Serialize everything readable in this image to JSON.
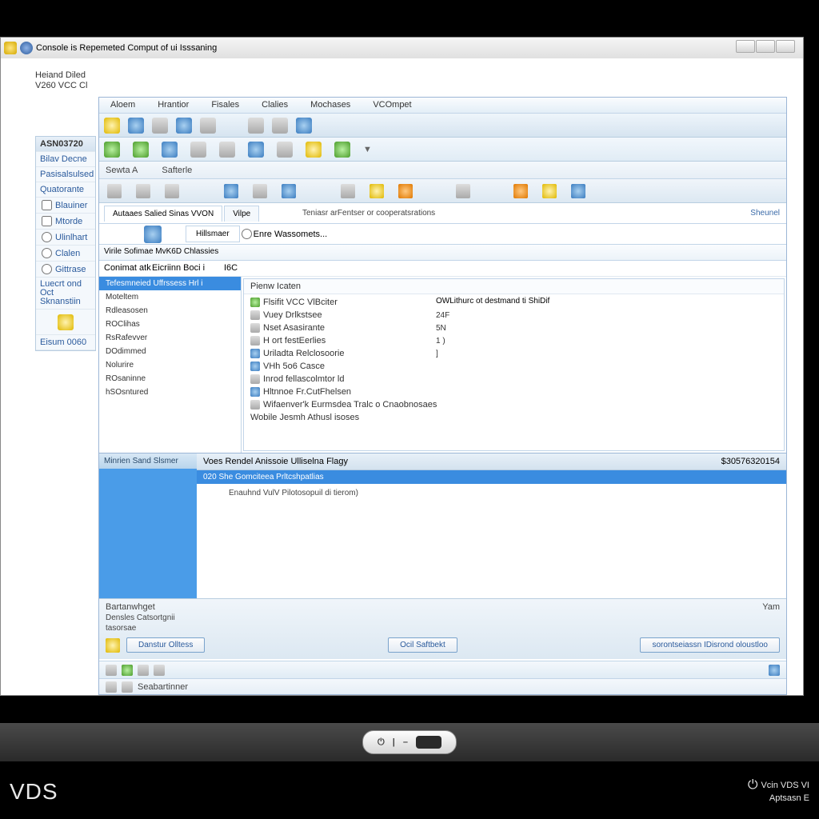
{
  "title": "Console is Repemeted Comput of ui Isssaning",
  "topleft": {
    "l1": "Heiand Diled",
    "l2": "V260 VCC Cl"
  },
  "menu": [
    "Aloem",
    "Hrantior",
    "Fisales",
    "Clalies",
    "Mochases",
    "VCOmpet"
  ],
  "subbar": {
    "l": "Sewta   A",
    "r": "Safterle"
  },
  "leftpanel": {
    "hdr": "ASN03720",
    "items": [
      "Bilav Decne",
      "Pasisalsulsed",
      "Quatorante",
      "Blauiner",
      "Mtorde"
    ],
    "radios": [
      "Ulinlhart",
      "Clalen",
      "Gittrase"
    ],
    "multi": "Luecrt ond Oct Sknanstiin",
    "foot": "Eisum 0060"
  },
  "tabs": {
    "t1": "Autaaes Salied Sinas VVON",
    "t2": "Vilpe",
    "info": "Teniasr arFentser or cooperatsrations"
  },
  "subtabs": {
    "icon_lbl": "",
    "st1": "Hillsmaer",
    "r1": "Enre Wassomets..."
  },
  "grouphdr": "Virile Sofimae MvK6D Chlassies",
  "grouprow": {
    "c1": "Conimat atk",
    "c2": "Eicriinn Boci i",
    "c3": "I6C"
  },
  "leftlist": {
    "sel": "Tefesmneied Uffrssess Hrl i",
    "items": [
      "Moteltem",
      "Rdleasosen",
      "ROClihas",
      "RsRafevver",
      "DOdimmed",
      "Nolurire",
      "ROsaninne",
      "hSOsntured"
    ]
  },
  "rightpane": {
    "hdr": "Pienw Icaten",
    "toprt": "OWLithurc ot destmand ti ShiDif",
    "props": [
      {
        "k": "Flsifit VCC VlBciter",
        "v": ""
      },
      {
        "k": "Vuey Drlkstsee",
        "v": "24F"
      },
      {
        "k": "Nset Asasirante",
        "v": "5N"
      },
      {
        "k": "H ort festEerlies",
        "v": "1 )"
      },
      {
        "k": "Uriladta Relclosoorie",
        "v": "]"
      },
      {
        "k": "VHh 5o6 Casce",
        "v": ""
      },
      {
        "k": "Inrod fellascolmtor ld",
        "v": ""
      },
      {
        "k": "Hltnnoe Fr.CutFhelsen",
        "v": ""
      },
      {
        "k": "Wifaenver'k Eurmsdea Tralc o Cnaobnosaes",
        "v": ""
      },
      {
        "k": "Wobile Jesmh Athusl isoses",
        "v": ""
      }
    ]
  },
  "bluepane": {
    "lhdr": "Minrien Sand Slsmer",
    "rhdr": "Voes Rendel Anissoie Ulliselna Flagy",
    "ramt": "$30576320154",
    "sel": "020    She Gomciteea Prltcshpatlias",
    "txt": "Enauhnd VulV Pilotosopuil di tierom)"
  },
  "bottom": {
    "l1": "Bartanwhget",
    "l2": "Densles Catsortgnii",
    "l3": "tasorsae",
    "b1": "Danstur Olltess",
    "b2": "Ocil Saftbekt",
    "b3": "sorontseiassn IDisrond oloustloo",
    "yr": "Yam"
  },
  "status": "Seabartinner",
  "brand": "VDS",
  "brand2a": "Vcin VDS VI",
  "brand2b": "Aptsasn  E"
}
